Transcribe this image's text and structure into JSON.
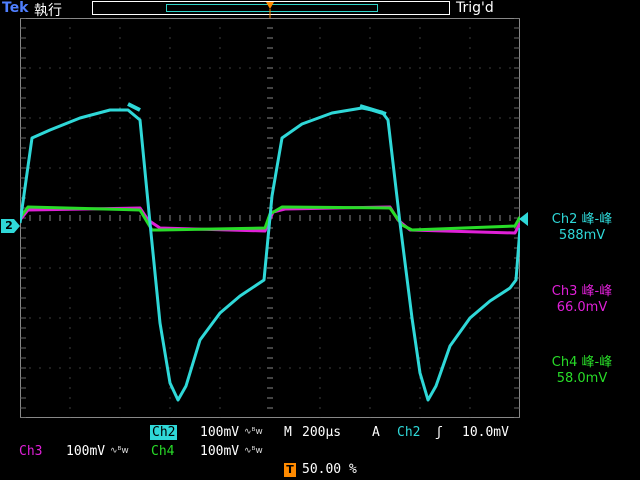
{
  "header": {
    "logo": "Tek",
    "run_status": "執行",
    "trigger_status": "Trig'd",
    "trigger_position_badge": "T"
  },
  "waveform_area": {
    "channel_marker": "2",
    "trace_colors": {
      "ch2": "#2fd8d8",
      "ch3": "#e020d8",
      "ch4": "#28dc28"
    }
  },
  "measurements": [
    {
      "label": "Ch2 峰-峰",
      "value": "588mV",
      "color": "#2fd8d8"
    },
    {
      "label": "Ch3 峰-峰",
      "value": "66.0mV",
      "color": "#e020d8"
    },
    {
      "label": "Ch4 峰-峰",
      "value": "58.0mV",
      "color": "#28dc28"
    }
  ],
  "footer": {
    "ch2_label": "Ch2",
    "ch2_scale": "100mV",
    "ch3_label": "Ch3",
    "ch3_scale": "100mV",
    "ch4_label": "Ch4",
    "ch4_scale": "100mV",
    "bw_icon": "∿ᴮw",
    "timebase_prefix": "M",
    "timebase": "200µs",
    "trigger_mode": "A",
    "trigger_source": "Ch2",
    "trigger_slope_icon": "ʃ",
    "trigger_level": "10.0mV",
    "trigger_badge": "T",
    "trigger_position": "50.00 %"
  }
}
